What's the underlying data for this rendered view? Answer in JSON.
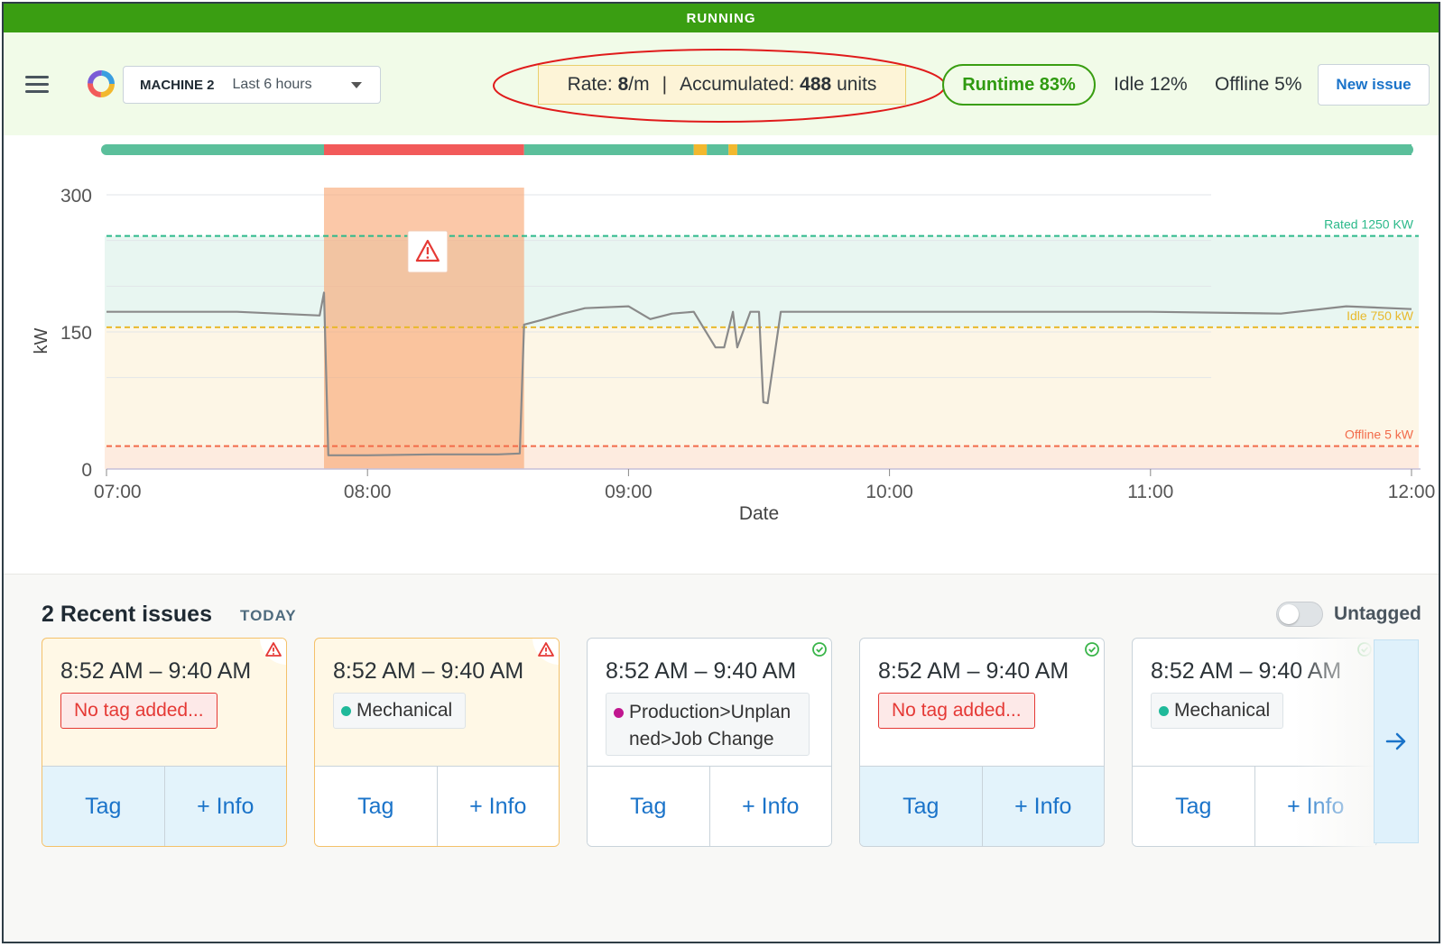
{
  "status": {
    "text": "RUNNING",
    "color": "#3a9e12"
  },
  "header": {
    "menu_icon": "hamburger-icon",
    "logo_icon": "ring-logo-icon",
    "machine": "MACHINE 2",
    "range": "Last 6 hours",
    "rate_label": "Rate:",
    "rate_value": "8",
    "rate_unit": "/m",
    "separator": "|",
    "accumulated_label": "Accumulated:",
    "accumulated_value": "488",
    "accumulated_unit": "units",
    "runtime": "Runtime 83%",
    "idle": "Idle 12%",
    "offline": "Offline 5%",
    "new_issue": "New issue"
  },
  "chart_data": {
    "type": "line",
    "title": "",
    "xlabel": "Date",
    "ylabel": "kW",
    "ylim": [
      0,
      300
    ],
    "yticks": [
      "0",
      "150",
      "300"
    ],
    "xticks": [
      "07:00",
      "08:00",
      "09:00",
      "10:00",
      "11:00",
      "12:00"
    ],
    "threshold_lines": [
      {
        "label": "Rated 1250 KW",
        "value": 255,
        "color": "#2bb98a"
      },
      {
        "label": "Idle 750 kW",
        "value": 155,
        "color": "#e8b92c"
      },
      {
        "label": "Offline 5 kW",
        "value": 25,
        "color": "#f26b4a"
      }
    ],
    "highlight": {
      "from": "07:50",
      "to": "08:36",
      "icon": "warning-icon"
    },
    "series": [
      {
        "x": [
          "07:00",
          "07:30",
          "07:49",
          "07:50",
          "07:51",
          "08:00",
          "08:15",
          "08:30",
          "08:35",
          "08:36",
          "08:40",
          "08:45",
          "08:50",
          "09:00",
          "09:05",
          "09:10",
          "09:15",
          "09:20",
          "09:22",
          "09:24",
          "09:25",
          "09:28",
          "09:30",
          "09:31",
          "09:32",
          "09:35",
          "10:00",
          "10:30",
          "11:00",
          "11:30",
          "11:45",
          "12:00"
        ],
        "y": [
          172,
          172,
          168,
          193,
          15,
          15,
          16,
          16,
          17,
          158,
          163,
          170,
          176,
          178,
          164,
          170,
          172,
          133,
          133,
          172,
          133,
          172,
          172,
          73,
          72,
          172,
          172,
          172,
          172,
          170,
          178,
          175
        ]
      }
    ],
    "status_timeline": [
      {
        "from": "07:00",
        "to": "07:50",
        "state": "running",
        "color": "#5bbf9b"
      },
      {
        "from": "07:50",
        "to": "08:36",
        "state": "offline",
        "color": "#f25a5a"
      },
      {
        "from": "08:36",
        "to": "09:15",
        "state": "running",
        "color": "#5bbf9b"
      },
      {
        "from": "09:15",
        "to": "09:18",
        "state": "idle",
        "color": "#f2b82e"
      },
      {
        "from": "09:18",
        "to": "09:23",
        "state": "running",
        "color": "#5bbf9b"
      },
      {
        "from": "09:23",
        "to": "09:25",
        "state": "idle",
        "color": "#f2b82e"
      },
      {
        "from": "09:25",
        "to": "12:00",
        "state": "running",
        "color": "#5bbf9b"
      }
    ]
  },
  "issues": {
    "title": "2 Recent issues",
    "period": "TODAY",
    "toggle_label": "Untagged",
    "cards": [
      {
        "time": "8:52 AM – 9:40 AM",
        "tag": "No tag added...",
        "tag_kind": "none",
        "status_icon": "warning-icon",
        "tag_btn": "Tag",
        "info_btn": "+ Info"
      },
      {
        "time": "8:52 AM – 9:40 AM",
        "tag": "Mechanical",
        "tag_kind": "plain",
        "dot_color": "#1fb99a",
        "status_icon": "warning-icon",
        "tag_btn": "Tag",
        "info_btn": "+ Info"
      },
      {
        "time": "8:52 AM – 9:40 AM",
        "tag": "Production>Unplanned>Job Change",
        "tag_line1": "Production>Unplan",
        "tag_line2": "ned>Job Change",
        "tag_kind": "multi",
        "dot_color": "#c0168f",
        "status_icon": "check-circle-icon",
        "tag_btn": "Tag",
        "info_btn": "+ Info"
      },
      {
        "time": "8:52 AM – 9:40 AM",
        "tag": "No tag added...",
        "tag_kind": "none",
        "status_icon": "check-circle-icon",
        "tag_btn": "Tag",
        "info_btn": "+ Info"
      },
      {
        "time": "8:52 AM – 9:40 AM",
        "tag": "Mechanical",
        "tag_kind": "plain",
        "dot_color": "#1fb99a",
        "status_icon": "check-circle-icon",
        "tag_btn": "Tag",
        "info_btn": "+ Info"
      }
    ],
    "next_icon": "arrow-right-icon"
  }
}
